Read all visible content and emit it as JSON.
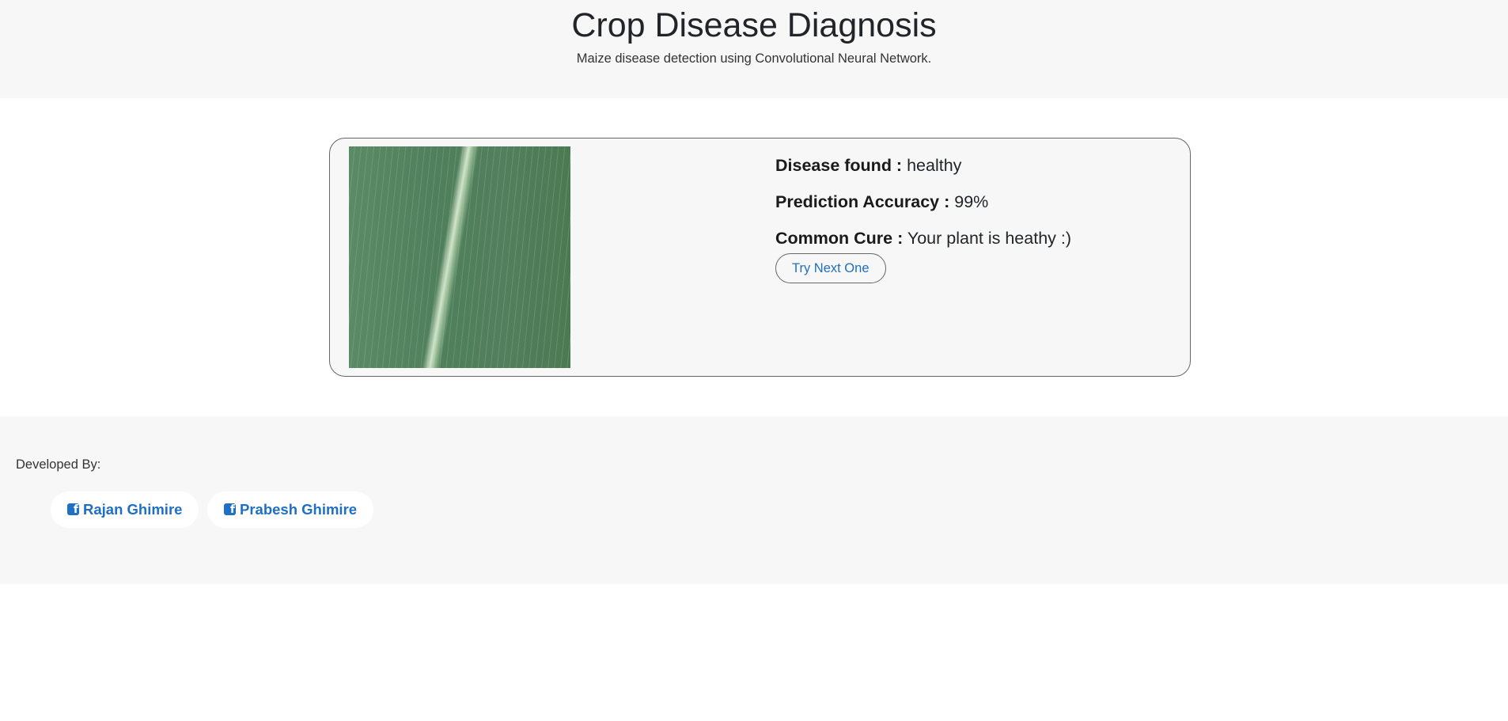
{
  "header": {
    "title": "Crop Disease Diagnosis",
    "subtitle": "Maize disease detection using Convolutional Neural Network."
  },
  "result": {
    "disease_label": "Disease found :",
    "disease_value": "healthy",
    "accuracy_label": "Prediction Accuracy :",
    "accuracy_value": "99%",
    "cure_label": "Common Cure :",
    "cure_value": "Your plant is heathy :)",
    "try_next_label": "Try Next One"
  },
  "footer": {
    "developed_by": "Developed By:",
    "developers": [
      {
        "name": "Rajan Ghimire",
        "icon": "facebook-icon"
      },
      {
        "name": "Prabesh Ghimire",
        "icon": "facebook-icon"
      }
    ]
  },
  "colors": {
    "link": "#1f6fc5",
    "panel": "#f7f7f7"
  }
}
